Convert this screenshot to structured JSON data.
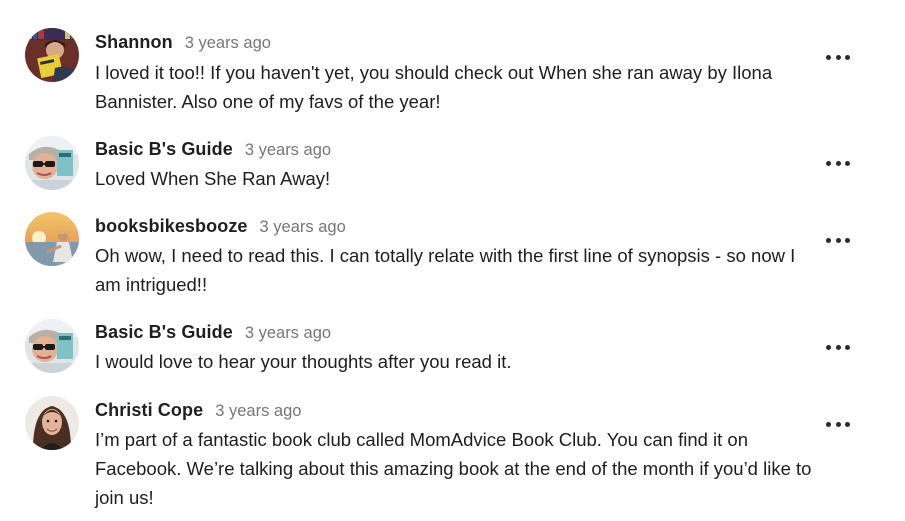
{
  "comments": [
    {
      "author": "Shannon",
      "time": "3 years ago",
      "text": "I loved it too!! If you haven't yet, you should check out When she ran away by Ilona Bannister. Also one of my favs of the year!",
      "avatar": "reader-holding-book-avatar"
    },
    {
      "author": "Basic B's Guide",
      "time": "3 years ago",
      "text": "Loved When She Ran Away!",
      "avatar": "sunglasses-selfie-avatar"
    },
    {
      "author": "booksbikesbooze",
      "time": "3 years ago",
      "text": "Oh wow, I need to read this. I can totally relate with the first line of synopsis - so now I am intrigued!!",
      "avatar": "sunset-beach-avatar"
    },
    {
      "author": "Basic B's Guide",
      "time": "3 years ago",
      "text": "I would love to hear your thoughts after you read it.",
      "avatar": "sunglasses-selfie-avatar"
    },
    {
      "author": "Christi Cope",
      "time": "3 years ago",
      "text": "I’m part of a fantastic book club called MomAdvice Book Club. You can find it on Facebook. We’re talking about this amazing book at the end of the month if you’d like to join us!",
      "avatar": "portrait-avatar"
    }
  ],
  "more_icon": "more-options-icon"
}
